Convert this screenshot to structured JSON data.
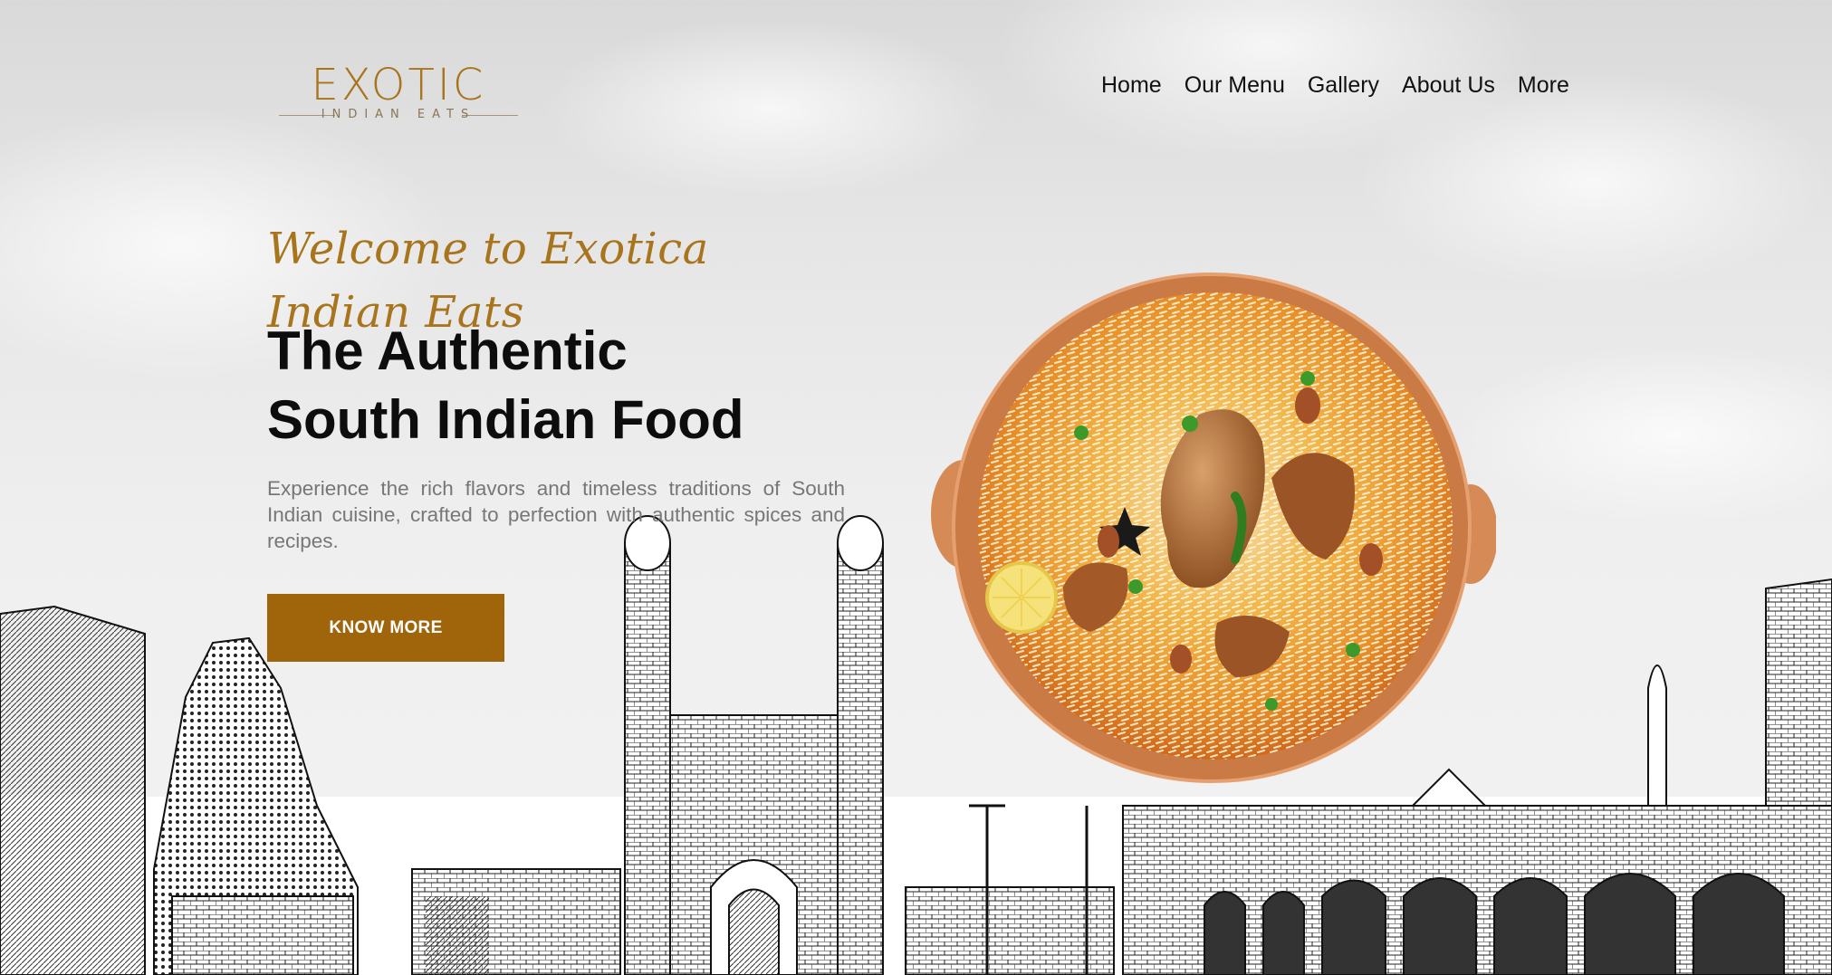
{
  "brand": {
    "name": "EXOTIC",
    "tagline": "INDIAN EATS",
    "color": "#a8741c"
  },
  "nav": {
    "items": [
      {
        "label": "Home"
      },
      {
        "label": "Our Menu"
      },
      {
        "label": "Gallery"
      },
      {
        "label": "About Us"
      },
      {
        "label": "More"
      }
    ]
  },
  "hero": {
    "welcome": "Welcome to Exotica Indian Eats",
    "headline_line1": "The Authentic",
    "headline_line2": "South Indian Food",
    "description": "Experience the rich flavors and timeless traditions of South Indian cuisine, crafted to perfection with authentic spices and recipes.",
    "cta_label": "KNOW MORE",
    "cta_color": "#a0650a"
  },
  "images": {
    "dish": "biryani-bowl",
    "background": "south-indian-landmarks-sketch"
  }
}
